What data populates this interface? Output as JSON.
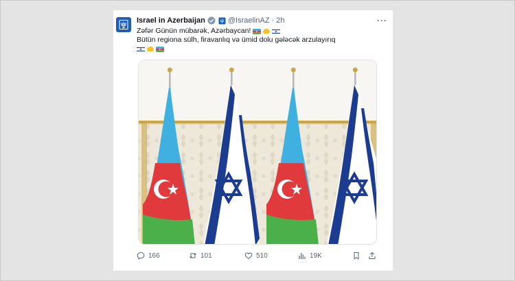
{
  "post": {
    "author_name": "Israel in Azerbaijan",
    "handle": "@IsraelinAZ",
    "separator": "·",
    "time": "2h",
    "more_label": "···",
    "line1": "Zəfər Günün mübarək, Azərbaycan!",
    "line2": "Bütün regiona sülh, firavanlıq və ümid dolu gələcək arzulayırıq",
    "line1_emoji": [
      "flag-azerbaijan-icon",
      "handshake-icon",
      "flag-israel-icon"
    ],
    "line3_emoji": [
      "flag-israel-icon",
      "handshake-icon",
      "flag-azerbaijan-icon"
    ]
  },
  "media": {
    "description_icon": "flags-photo",
    "flags": [
      "azerbaijan",
      "israel",
      "azerbaijan",
      "israel"
    ]
  },
  "actions": {
    "reply_count": "166",
    "retweet_count": "101",
    "like_count": "510",
    "views_count": "19K"
  },
  "colors": {
    "az_blue": "#3fb0e0",
    "az_red": "#e03a3c",
    "az_green": "#4bb04a",
    "il_blue": "#1b3c8f",
    "gold": "#c9a64a",
    "text_secondary": "#536471",
    "verified_gray": "#829aab"
  }
}
